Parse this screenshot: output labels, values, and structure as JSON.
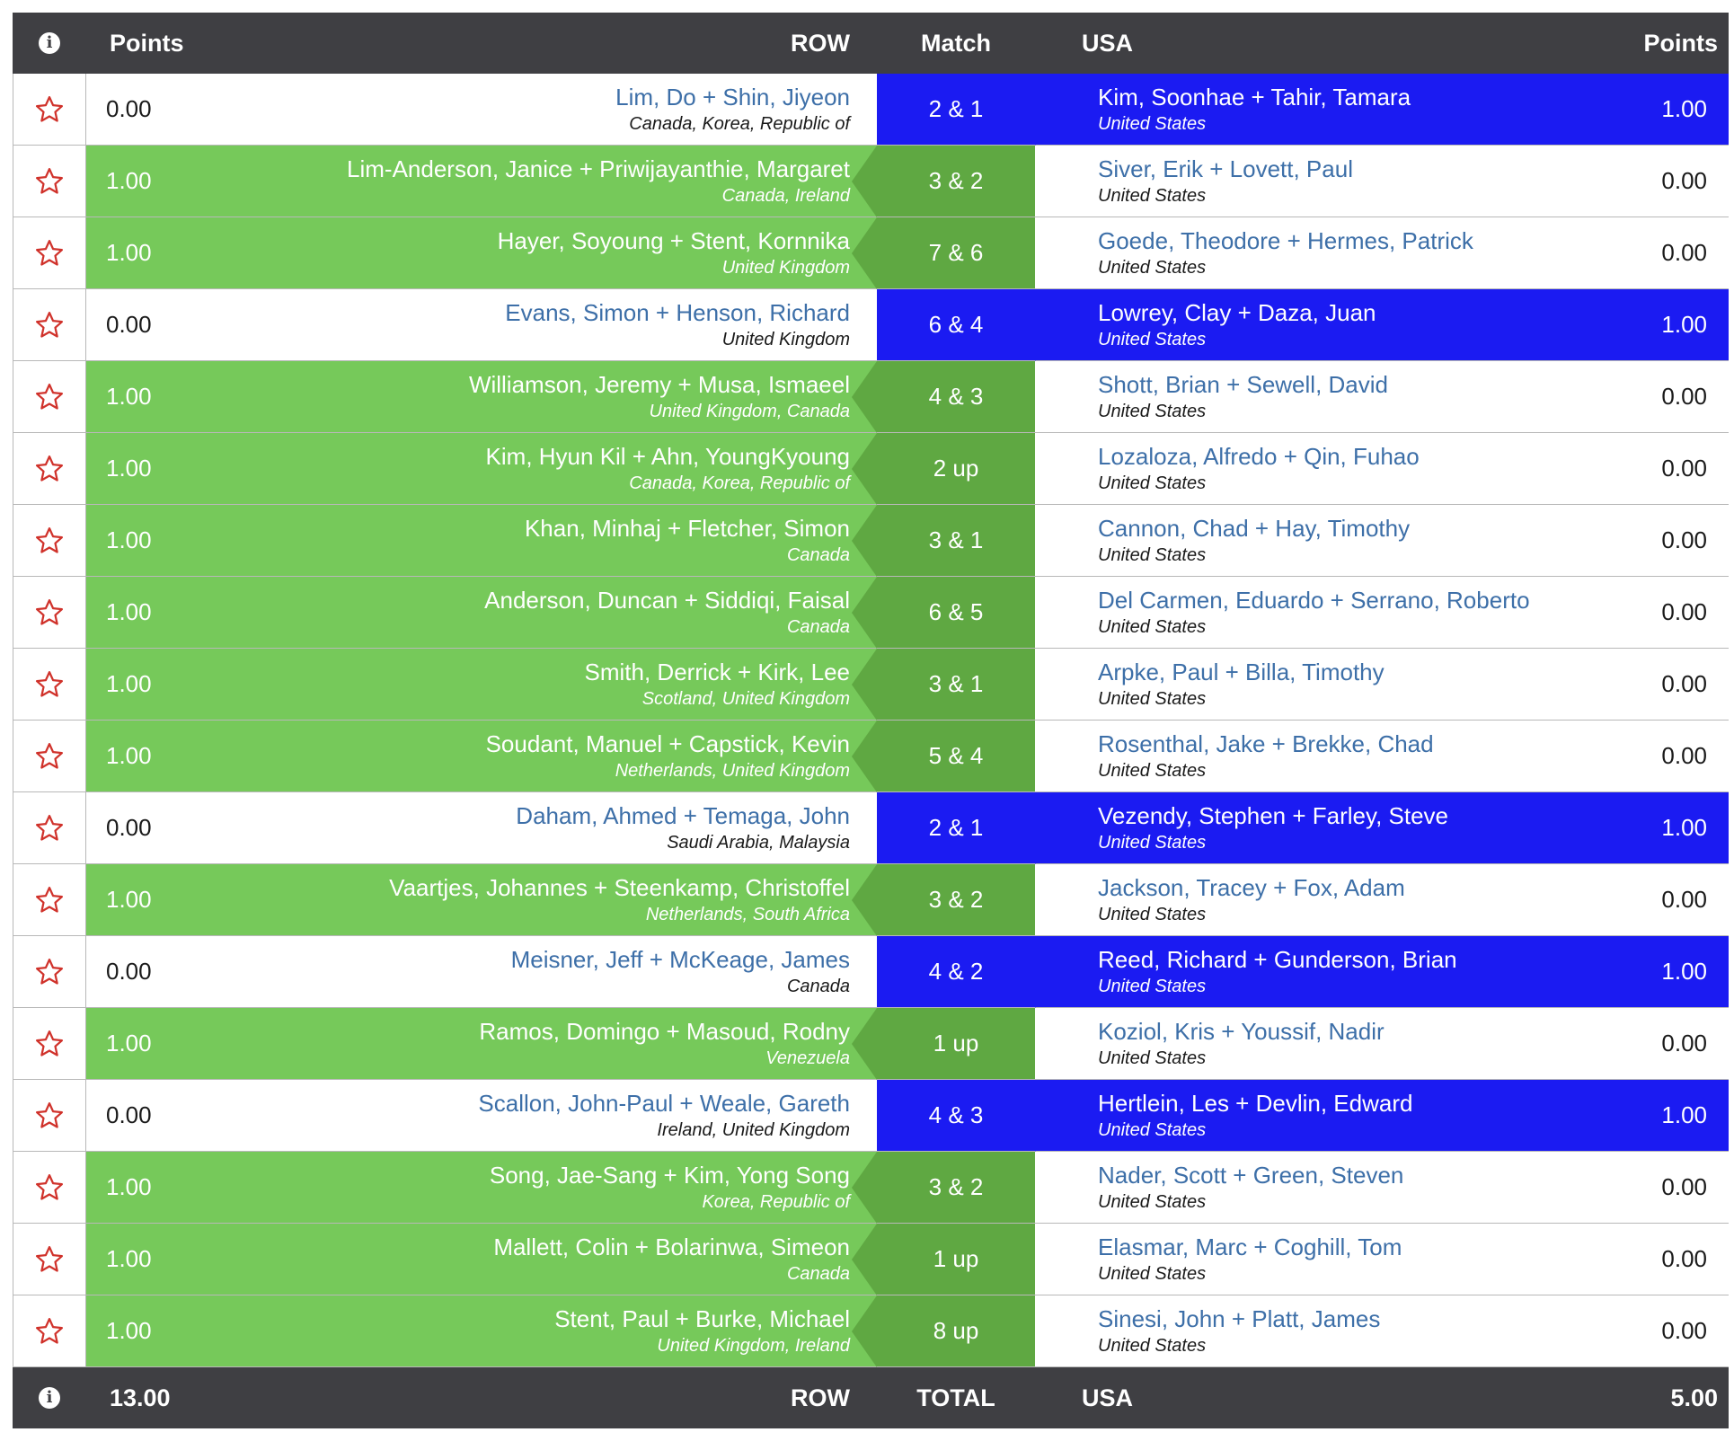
{
  "header": {
    "info_icon": "info-icon",
    "left_points_label": "Points",
    "left_team_label": "ROW",
    "match_label": "Match",
    "right_team_label": "USA",
    "right_points_label": "Points"
  },
  "colors": {
    "row_win_green": "#76c95a",
    "match_green": "#5fa842",
    "usa_win_blue": "#1b1bf2",
    "star_red": "#d0322b",
    "header_dark": "#3f3f43",
    "link_blue": "#3d6fa8"
  },
  "matches": [
    {
      "left_pts": "0.00",
      "left_names": "Lim, Do + Shin, Jiyeon",
      "left_countries": "Canada, Korea, Republic of",
      "result": "2 & 1",
      "winner": "right",
      "right_names": "Kim, Soonhae + Tahir, Tamara",
      "right_countries": "United States",
      "right_pts": "1.00"
    },
    {
      "left_pts": "1.00",
      "left_names": "Lim-Anderson, Janice + Priwijayanthie, Margaret",
      "left_countries": "Canada, Ireland",
      "result": "3 & 2",
      "winner": "left",
      "right_names": "Siver, Erik + Lovett, Paul",
      "right_countries": "United States",
      "right_pts": "0.00"
    },
    {
      "left_pts": "1.00",
      "left_names": "Hayer, Soyoung + Stent, Kornnika",
      "left_countries": "United Kingdom",
      "result": "7 & 6",
      "winner": "left",
      "right_names": "Goede, Theodore + Hermes, Patrick",
      "right_countries": "United States",
      "right_pts": "0.00"
    },
    {
      "left_pts": "0.00",
      "left_names": "Evans, Simon + Henson, Richard",
      "left_countries": "United Kingdom",
      "result": "6 & 4",
      "winner": "right",
      "right_names": "Lowrey, Clay + Daza, Juan",
      "right_countries": "United States",
      "right_pts": "1.00"
    },
    {
      "left_pts": "1.00",
      "left_names": "Williamson, Jeremy + Musa, Ismaeel",
      "left_countries": "United Kingdom, Canada",
      "result": "4 & 3",
      "winner": "left",
      "right_names": "Shott, Brian + Sewell, David",
      "right_countries": "United States",
      "right_pts": "0.00"
    },
    {
      "left_pts": "1.00",
      "left_names": "Kim, Hyun Kil + Ahn, YoungKyoung",
      "left_countries": "Canada, Korea, Republic of",
      "result": "2 up",
      "winner": "left",
      "right_names": "Lozaloza, Alfredo + Qin, Fuhao",
      "right_countries": "United States",
      "right_pts": "0.00"
    },
    {
      "left_pts": "1.00",
      "left_names": "Khan, Minhaj + Fletcher, Simon",
      "left_countries": "Canada",
      "result": "3 & 1",
      "winner": "left",
      "right_names": "Cannon, Chad + Hay, Timothy",
      "right_countries": "United States",
      "right_pts": "0.00"
    },
    {
      "left_pts": "1.00",
      "left_names": "Anderson, Duncan + Siddiqi, Faisal",
      "left_countries": "Canada",
      "result": "6 & 5",
      "winner": "left",
      "right_names": "Del Carmen, Eduardo + Serrano, Roberto",
      "right_countries": "United States",
      "right_pts": "0.00"
    },
    {
      "left_pts": "1.00",
      "left_names": "Smith, Derrick + Kirk, Lee",
      "left_countries": "Scotland, United Kingdom",
      "result": "3 & 1",
      "winner": "left",
      "right_names": "Arpke, Paul + Billa, Timothy",
      "right_countries": "United States",
      "right_pts": "0.00"
    },
    {
      "left_pts": "1.00",
      "left_names": "Soudant, Manuel + Capstick, Kevin",
      "left_countries": "Netherlands, United Kingdom",
      "result": "5 & 4",
      "winner": "left",
      "right_names": "Rosenthal, Jake + Brekke, Chad",
      "right_countries": "United States",
      "right_pts": "0.00"
    },
    {
      "left_pts": "0.00",
      "left_names": "Daham, Ahmed + Temaga, John",
      "left_countries": "Saudi Arabia, Malaysia",
      "result": "2 & 1",
      "winner": "right",
      "right_names": "Vezendy, Stephen + Farley, Steve",
      "right_countries": "United States",
      "right_pts": "1.00"
    },
    {
      "left_pts": "1.00",
      "left_names": "Vaartjes, Johannes + Steenkamp, Christoffel",
      "left_countries": "Netherlands, South Africa",
      "result": "3 & 2",
      "winner": "left",
      "right_names": "Jackson, Tracey + Fox, Adam",
      "right_countries": "United States",
      "right_pts": "0.00"
    },
    {
      "left_pts": "0.00",
      "left_names": "Meisner, Jeff + McKeage, James",
      "left_countries": "Canada",
      "result": "4 & 2",
      "winner": "right",
      "right_names": "Reed, Richard + Gunderson, Brian",
      "right_countries": "United States",
      "right_pts": "1.00"
    },
    {
      "left_pts": "1.00",
      "left_names": "Ramos, Domingo + Masoud, Rodny",
      "left_countries": "Venezuela",
      "result": "1 up",
      "winner": "left",
      "right_names": "Koziol, Kris + Youssif, Nadir",
      "right_countries": "United States",
      "right_pts": "0.00"
    },
    {
      "left_pts": "0.00",
      "left_names": "Scallon, John-Paul + Weale, Gareth",
      "left_countries": "Ireland, United Kingdom",
      "result": "4 & 3",
      "winner": "right",
      "right_names": "Hertlein, Les + Devlin, Edward",
      "right_countries": "United States",
      "right_pts": "1.00"
    },
    {
      "left_pts": "1.00",
      "left_names": "Song, Jae-Sang + Kim, Yong Song",
      "left_countries": "Korea, Republic of",
      "result": "3 & 2",
      "winner": "left",
      "right_names": "Nader, Scott + Green, Steven",
      "right_countries": "United States",
      "right_pts": "0.00"
    },
    {
      "left_pts": "1.00",
      "left_names": "Mallett, Colin + Bolarinwa, Simeon",
      "left_countries": "Canada",
      "result": "1 up",
      "winner": "left",
      "right_names": "Elasmar, Marc + Coghill, Tom",
      "right_countries": "United States",
      "right_pts": "0.00"
    },
    {
      "left_pts": "1.00",
      "left_names": "Stent, Paul + Burke, Michael",
      "left_countries": "United Kingdom, Ireland",
      "result": "8 up",
      "winner": "left",
      "right_names": "Sinesi, John + Platt, James",
      "right_countries": "United States",
      "right_pts": "0.00"
    }
  ],
  "footer": {
    "left_total": "13.00",
    "left_team_label": "ROW",
    "total_label": "TOTAL",
    "right_team_label": "USA",
    "right_total": "5.00"
  }
}
